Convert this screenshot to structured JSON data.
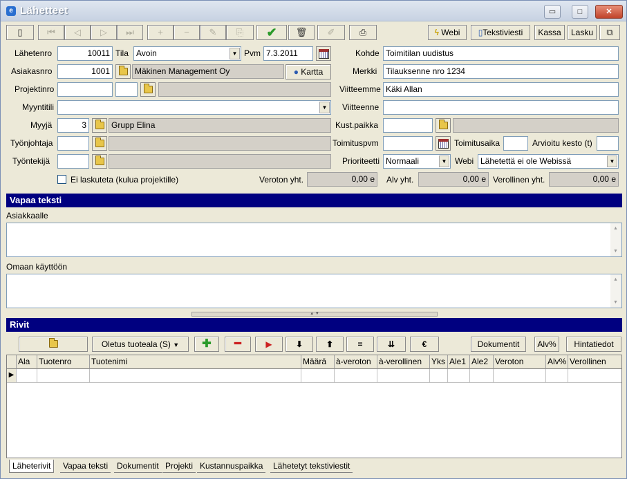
{
  "window": {
    "title": "Lähetteet",
    "min_glyph": "▭",
    "max_glyph": "□",
    "close_glyph": "✕"
  },
  "toolbar": {
    "webi": "Webi",
    "tekstiviesti": "Tekstiviesti",
    "kassa": "Kassa",
    "lasku": "Lasku"
  },
  "form": {
    "lahetenro_label": "Lähetenro",
    "lahetenro": "10011",
    "tila_label": "Tila",
    "tila": "Avoin",
    "pvm_label": "Pvm",
    "pvm": "7.3.2011",
    "asiakasnro_label": "Asiakasnro",
    "asiakasnro": "1001",
    "asiakas_nimi": "Mäkinen Management Oy",
    "kartta": "Kartta",
    "projektinro_label": "Projektinro",
    "myyntitili_label": "Myyntitili",
    "myyja_label": "Myyjä",
    "myyja": "3",
    "myyja_nimi": "Grupp Elina",
    "tyonjohtaja_label": "Työnjohtaja",
    "tyontekija_label": "Työntekijä",
    "kohde_label": "Kohde",
    "kohde": "Toimitilan uudistus",
    "merkki_label": "Merkki",
    "merkki": "Tilauksenne nro 1234",
    "viitteemme_label": "Viitteemme",
    "viitteemme": "Käki Allan",
    "viitteenne_label": "Viitteenne",
    "kustpaikka_label": "Kust.paikka",
    "toimituspvm_label": "Toimituspvm",
    "toimitusaika_label": "Toimitusaika",
    "arvioitu_kesto_label": "Arvioitu kesto (t)",
    "prioriteetti_label": "Prioriteetti",
    "prioriteetti": "Normaali",
    "webi_label": "Webi",
    "webi_status": "Lähetettä ei ole Webissä"
  },
  "totals": {
    "ei_laskuteta_label": "Ei laskuteta (kulua projektille)",
    "veroton_label": "Veroton yht.",
    "veroton": "0,00 e",
    "alv_label": "Alv yht.",
    "alv": "0,00 e",
    "verollinen_label": "Verollinen yht.",
    "verollinen": "0,00 e"
  },
  "vapaa_teksti": {
    "header": "Vapaa teksti",
    "asiakkaalle_label": "Asiakkaalle",
    "omaan_label": "Omaan käyttöön"
  },
  "rivit": {
    "header": "Rivit",
    "oletus_tuoteala": "Oletus tuoteala (S)",
    "equals": "=",
    "euro": "€",
    "dokumentit": "Dokumentit",
    "alv_pct": "Alv%",
    "hintatiedot": "Hintatiedot",
    "columns": [
      "Ala",
      "Tuotenro",
      "Tuotenimi",
      "Määrä",
      "à-veroton",
      "à-verollinen",
      "Yks",
      "Ale1",
      "Ale2",
      "Veroton",
      "Alv%",
      "Verollinen"
    ]
  },
  "tabs": [
    "Läheterivit",
    "Vapaa teksti",
    "Dokumentit",
    "Projekti",
    "Kustannuspaikka",
    "Lähetetyt tekstiviestit"
  ],
  "colors": {
    "header_bg": "#000080",
    "window_bg": "#ece9d8",
    "check_green": "#2a9a2a",
    "plus_green": "#2a9a2a",
    "minus_red": "#cc2222"
  }
}
